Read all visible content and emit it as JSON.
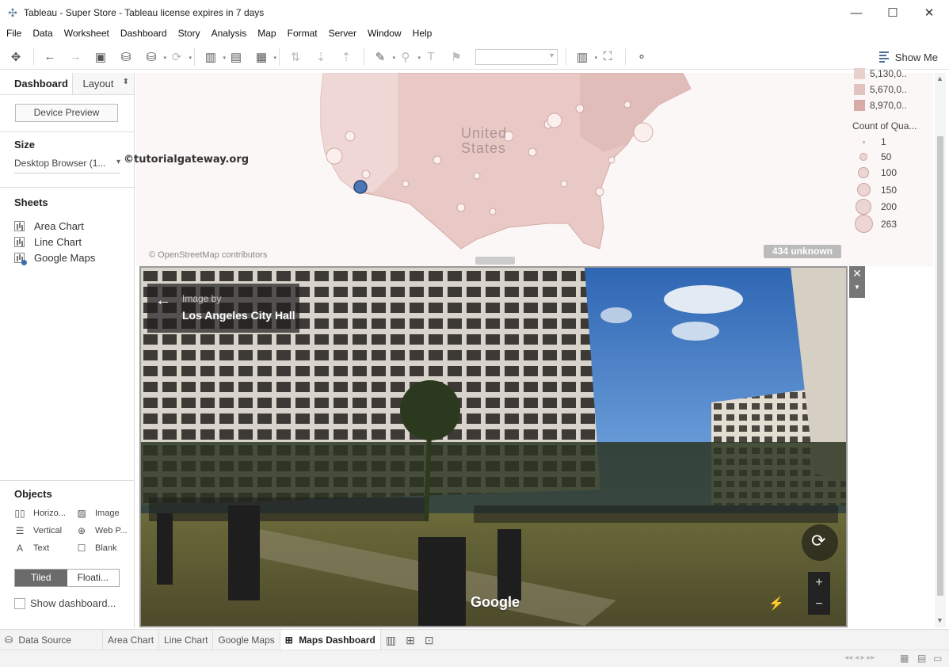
{
  "window": {
    "title": "Tableau - Super Store - Tableau license expires in 7 days",
    "minimize": "—",
    "maximize": "☐",
    "close": "✕"
  },
  "menu": [
    "File",
    "Data",
    "Worksheet",
    "Dashboard",
    "Story",
    "Analysis",
    "Map",
    "Format",
    "Server",
    "Window",
    "Help"
  ],
  "toolbar": {
    "show_me": "Show Me"
  },
  "left_panel": {
    "tab_dashboard": "Dashboard",
    "tab_layout": "Layout",
    "device_preview": "Device Preview",
    "size_heading": "Size",
    "size_value": "Desktop Browser (1...",
    "sheets_heading": "Sheets",
    "sheets": [
      "Area Chart",
      "Line Chart",
      "Google Maps"
    ],
    "objects_heading": "Objects",
    "objects": {
      "horizontal": "Horizo...",
      "image": "Image",
      "vertical": "Vertical",
      "web_page": "Web P...",
      "text": "Text",
      "blank": "Blank"
    },
    "tiled": "Tiled",
    "floating": "Floati...",
    "show_dashboard_title": "Show dashboard..."
  },
  "map": {
    "country_label_1": "United",
    "country_label_2": "States",
    "attribution": "© OpenStreetMap contributors",
    "unknown_badge": "434 unknown",
    "watermark": "©tutorialgateway.org",
    "legend_color": [
      "5,130,0..",
      "5,670,0..",
      "8,970,0.."
    ],
    "legend_count_title": "Count of Qua...",
    "legend_count": [
      "1",
      "50",
      "100",
      "150",
      "200",
      "263"
    ]
  },
  "streetview": {
    "image_by": "Image by",
    "place": "Los Angeles City Hall",
    "google": "Google",
    "zoom_in": "+",
    "zoom_out": "−"
  },
  "tabs": {
    "data_source": "Data Source",
    "sheets": [
      "Area Chart",
      "Line Chart",
      "Google Maps"
    ],
    "active": "Maps Dashboard"
  }
}
